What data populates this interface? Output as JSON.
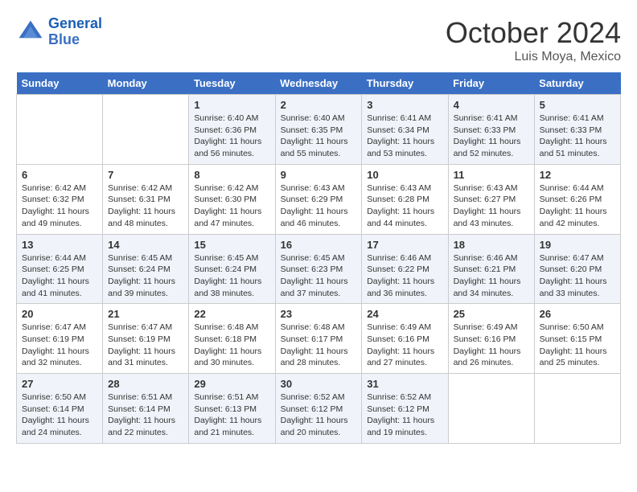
{
  "logo": {
    "line1": "General",
    "line2": "Blue"
  },
  "title": "October 2024",
  "location": "Luis Moya, Mexico",
  "days_header": [
    "Sunday",
    "Monday",
    "Tuesday",
    "Wednesday",
    "Thursday",
    "Friday",
    "Saturday"
  ],
  "weeks": [
    [
      {
        "day": "",
        "sunrise": "",
        "sunset": "",
        "daylight": ""
      },
      {
        "day": "",
        "sunrise": "",
        "sunset": "",
        "daylight": ""
      },
      {
        "day": "1",
        "sunrise": "Sunrise: 6:40 AM",
        "sunset": "Sunset: 6:36 PM",
        "daylight": "Daylight: 11 hours and 56 minutes."
      },
      {
        "day": "2",
        "sunrise": "Sunrise: 6:40 AM",
        "sunset": "Sunset: 6:35 PM",
        "daylight": "Daylight: 11 hours and 55 minutes."
      },
      {
        "day": "3",
        "sunrise": "Sunrise: 6:41 AM",
        "sunset": "Sunset: 6:34 PM",
        "daylight": "Daylight: 11 hours and 53 minutes."
      },
      {
        "day": "4",
        "sunrise": "Sunrise: 6:41 AM",
        "sunset": "Sunset: 6:33 PM",
        "daylight": "Daylight: 11 hours and 52 minutes."
      },
      {
        "day": "5",
        "sunrise": "Sunrise: 6:41 AM",
        "sunset": "Sunset: 6:33 PM",
        "daylight": "Daylight: 11 hours and 51 minutes."
      }
    ],
    [
      {
        "day": "6",
        "sunrise": "Sunrise: 6:42 AM",
        "sunset": "Sunset: 6:32 PM",
        "daylight": "Daylight: 11 hours and 49 minutes."
      },
      {
        "day": "7",
        "sunrise": "Sunrise: 6:42 AM",
        "sunset": "Sunset: 6:31 PM",
        "daylight": "Daylight: 11 hours and 48 minutes."
      },
      {
        "day": "8",
        "sunrise": "Sunrise: 6:42 AM",
        "sunset": "Sunset: 6:30 PM",
        "daylight": "Daylight: 11 hours and 47 minutes."
      },
      {
        "day": "9",
        "sunrise": "Sunrise: 6:43 AM",
        "sunset": "Sunset: 6:29 PM",
        "daylight": "Daylight: 11 hours and 46 minutes."
      },
      {
        "day": "10",
        "sunrise": "Sunrise: 6:43 AM",
        "sunset": "Sunset: 6:28 PM",
        "daylight": "Daylight: 11 hours and 44 minutes."
      },
      {
        "day": "11",
        "sunrise": "Sunrise: 6:43 AM",
        "sunset": "Sunset: 6:27 PM",
        "daylight": "Daylight: 11 hours and 43 minutes."
      },
      {
        "day": "12",
        "sunrise": "Sunrise: 6:44 AM",
        "sunset": "Sunset: 6:26 PM",
        "daylight": "Daylight: 11 hours and 42 minutes."
      }
    ],
    [
      {
        "day": "13",
        "sunrise": "Sunrise: 6:44 AM",
        "sunset": "Sunset: 6:25 PM",
        "daylight": "Daylight: 11 hours and 41 minutes."
      },
      {
        "day": "14",
        "sunrise": "Sunrise: 6:45 AM",
        "sunset": "Sunset: 6:24 PM",
        "daylight": "Daylight: 11 hours and 39 minutes."
      },
      {
        "day": "15",
        "sunrise": "Sunrise: 6:45 AM",
        "sunset": "Sunset: 6:24 PM",
        "daylight": "Daylight: 11 hours and 38 minutes."
      },
      {
        "day": "16",
        "sunrise": "Sunrise: 6:45 AM",
        "sunset": "Sunset: 6:23 PM",
        "daylight": "Daylight: 11 hours and 37 minutes."
      },
      {
        "day": "17",
        "sunrise": "Sunrise: 6:46 AM",
        "sunset": "Sunset: 6:22 PM",
        "daylight": "Daylight: 11 hours and 36 minutes."
      },
      {
        "day": "18",
        "sunrise": "Sunrise: 6:46 AM",
        "sunset": "Sunset: 6:21 PM",
        "daylight": "Daylight: 11 hours and 34 minutes."
      },
      {
        "day": "19",
        "sunrise": "Sunrise: 6:47 AM",
        "sunset": "Sunset: 6:20 PM",
        "daylight": "Daylight: 11 hours and 33 minutes."
      }
    ],
    [
      {
        "day": "20",
        "sunrise": "Sunrise: 6:47 AM",
        "sunset": "Sunset: 6:19 PM",
        "daylight": "Daylight: 11 hours and 32 minutes."
      },
      {
        "day": "21",
        "sunrise": "Sunrise: 6:47 AM",
        "sunset": "Sunset: 6:19 PM",
        "daylight": "Daylight: 11 hours and 31 minutes."
      },
      {
        "day": "22",
        "sunrise": "Sunrise: 6:48 AM",
        "sunset": "Sunset: 6:18 PM",
        "daylight": "Daylight: 11 hours and 30 minutes."
      },
      {
        "day": "23",
        "sunrise": "Sunrise: 6:48 AM",
        "sunset": "Sunset: 6:17 PM",
        "daylight": "Daylight: 11 hours and 28 minutes."
      },
      {
        "day": "24",
        "sunrise": "Sunrise: 6:49 AM",
        "sunset": "Sunset: 6:16 PM",
        "daylight": "Daylight: 11 hours and 27 minutes."
      },
      {
        "day": "25",
        "sunrise": "Sunrise: 6:49 AM",
        "sunset": "Sunset: 6:16 PM",
        "daylight": "Daylight: 11 hours and 26 minutes."
      },
      {
        "day": "26",
        "sunrise": "Sunrise: 6:50 AM",
        "sunset": "Sunset: 6:15 PM",
        "daylight": "Daylight: 11 hours and 25 minutes."
      }
    ],
    [
      {
        "day": "27",
        "sunrise": "Sunrise: 6:50 AM",
        "sunset": "Sunset: 6:14 PM",
        "daylight": "Daylight: 11 hours and 24 minutes."
      },
      {
        "day": "28",
        "sunrise": "Sunrise: 6:51 AM",
        "sunset": "Sunset: 6:14 PM",
        "daylight": "Daylight: 11 hours and 22 minutes."
      },
      {
        "day": "29",
        "sunrise": "Sunrise: 6:51 AM",
        "sunset": "Sunset: 6:13 PM",
        "daylight": "Daylight: 11 hours and 21 minutes."
      },
      {
        "day": "30",
        "sunrise": "Sunrise: 6:52 AM",
        "sunset": "Sunset: 6:12 PM",
        "daylight": "Daylight: 11 hours and 20 minutes."
      },
      {
        "day": "31",
        "sunrise": "Sunrise: 6:52 AM",
        "sunset": "Sunset: 6:12 PM",
        "daylight": "Daylight: 11 hours and 19 minutes."
      },
      {
        "day": "",
        "sunrise": "",
        "sunset": "",
        "daylight": ""
      },
      {
        "day": "",
        "sunrise": "",
        "sunset": "",
        "daylight": ""
      }
    ]
  ]
}
